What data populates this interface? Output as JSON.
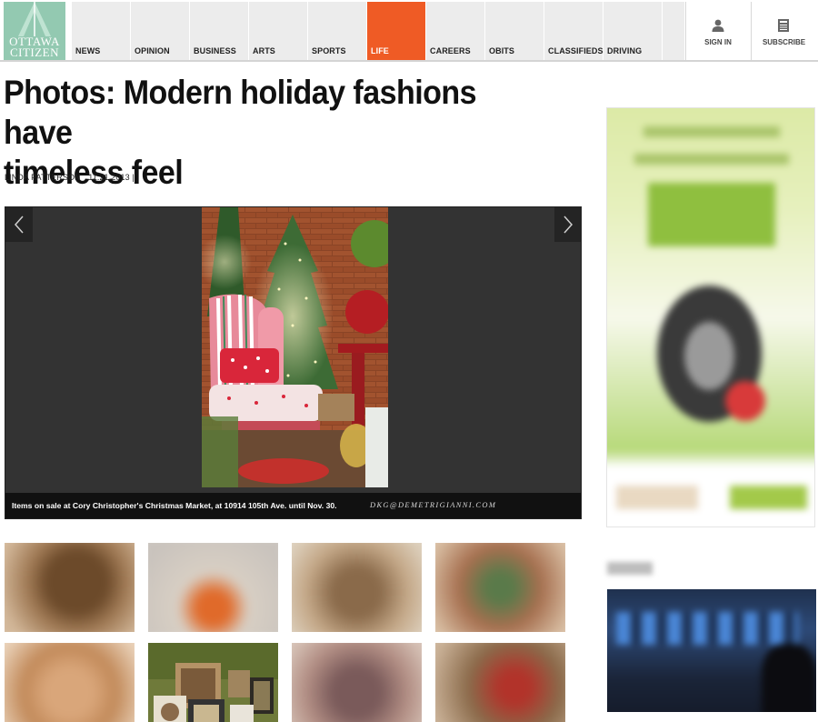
{
  "site": {
    "logo_line1": "OTTAWA",
    "logo_line2": "CITIZEN",
    "brand_color": "#93c9b1",
    "accent_color": "#ef5b25"
  },
  "nav": {
    "items": [
      {
        "label": "NEWS"
      },
      {
        "label": "OPINION"
      },
      {
        "label": "BUSINESS"
      },
      {
        "label": "ARTS"
      },
      {
        "label": "SPORTS"
      },
      {
        "label": "LIFE",
        "active": true
      },
      {
        "label": "CAREERS"
      },
      {
        "label": "OBITS"
      },
      {
        "label": "CLASSIFIEDS"
      },
      {
        "label": "DRIVING"
      }
    ],
    "sign_in": "SIGN IN",
    "subscribe": "SUBSCRIBE"
  },
  "article": {
    "headline_line1": "Photos: Modern holiday fashions have",
    "headline_line2": "timeless feel",
    "author": "LINDA PATTERSON",
    "date": "11.21.2013 |"
  },
  "gallery": {
    "caption": "Items on sale at Cory Christopher's Christmas Market, at 10914 105th Ave. until Nov. 30.",
    "credit": "DKG@DEMETRIGIANNI.COM",
    "prev_icon": "chevron-left-icon",
    "next_icon": "chevron-right-icon"
  },
  "icons": {
    "sign_in": "user-icon",
    "subscribe": "newspaper-icon"
  }
}
